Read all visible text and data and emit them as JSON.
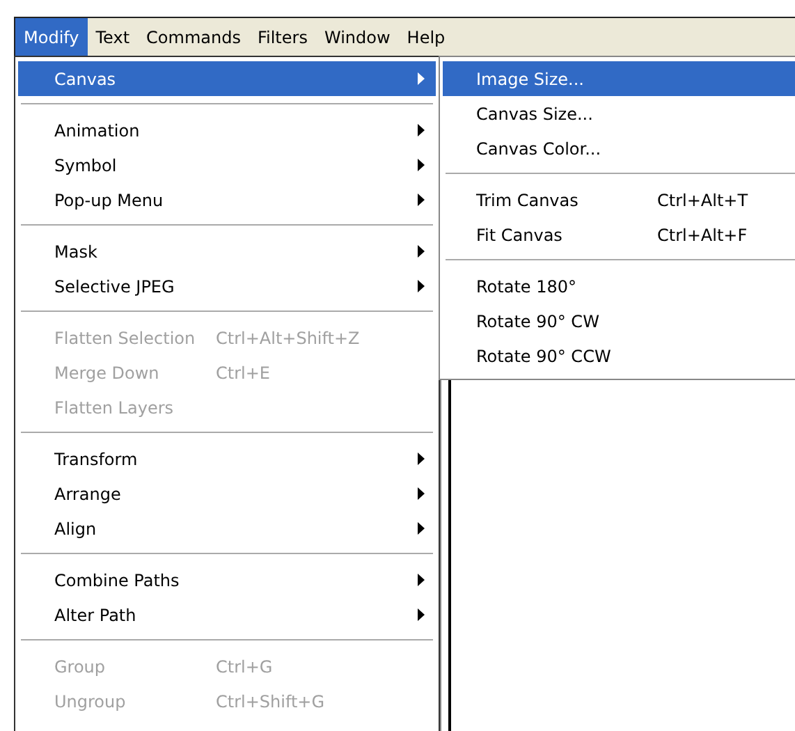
{
  "menubar": [
    {
      "label": "Modify",
      "selected": true
    },
    {
      "label": "Text",
      "selected": false
    },
    {
      "label": "Commands",
      "selected": false
    },
    {
      "label": "Filters",
      "selected": false
    },
    {
      "label": "Window",
      "selected": false
    },
    {
      "label": "Help",
      "selected": false
    }
  ],
  "menu": [
    {
      "kind": "item",
      "label": "Canvas",
      "submenu": true,
      "selected": true,
      "disabled": false
    },
    {
      "kind": "separator"
    },
    {
      "kind": "item",
      "label": "Animation",
      "submenu": true,
      "selected": false,
      "disabled": false
    },
    {
      "kind": "item",
      "label": "Symbol",
      "submenu": true,
      "selected": false,
      "disabled": false
    },
    {
      "kind": "item",
      "label": "Pop-up Menu",
      "submenu": true,
      "selected": false,
      "disabled": false
    },
    {
      "kind": "separator"
    },
    {
      "kind": "item",
      "label": "Mask",
      "submenu": true,
      "selected": false,
      "disabled": false
    },
    {
      "kind": "item",
      "label": "Selective JPEG",
      "submenu": true,
      "selected": false,
      "disabled": false
    },
    {
      "kind": "separator"
    },
    {
      "kind": "item",
      "label": "Flatten Selection",
      "shortcut": "Ctrl+Alt+Shift+Z",
      "selected": false,
      "disabled": true
    },
    {
      "kind": "item",
      "label": "Merge Down",
      "shortcut": "Ctrl+E",
      "selected": false,
      "disabled": true
    },
    {
      "kind": "item",
      "label": "Flatten Layers",
      "selected": false,
      "disabled": true
    },
    {
      "kind": "separator"
    },
    {
      "kind": "item",
      "label": "Transform",
      "submenu": true,
      "selected": false,
      "disabled": false
    },
    {
      "kind": "item",
      "label": "Arrange",
      "submenu": true,
      "selected": false,
      "disabled": false
    },
    {
      "kind": "item",
      "label": "Align",
      "submenu": true,
      "selected": false,
      "disabled": false
    },
    {
      "kind": "separator"
    },
    {
      "kind": "item",
      "label": "Combine Paths",
      "submenu": true,
      "selected": false,
      "disabled": false
    },
    {
      "kind": "item",
      "label": "Alter Path",
      "submenu": true,
      "selected": false,
      "disabled": false
    },
    {
      "kind": "separator"
    },
    {
      "kind": "item",
      "label": "Group",
      "shortcut": "Ctrl+G",
      "selected": false,
      "disabled": true
    },
    {
      "kind": "item",
      "label": "Ungroup",
      "shortcut": "Ctrl+Shift+G",
      "selected": false,
      "disabled": true
    }
  ],
  "submenu": [
    {
      "kind": "item",
      "label": "Image Size...",
      "selected": true,
      "disabled": false
    },
    {
      "kind": "item",
      "label": "Canvas Size...",
      "selected": false,
      "disabled": false
    },
    {
      "kind": "item",
      "label": "Canvas Color...",
      "selected": false,
      "disabled": false
    },
    {
      "kind": "separator"
    },
    {
      "kind": "item",
      "label": "Trim Canvas",
      "shortcut": "Ctrl+Alt+T",
      "selected": false,
      "disabled": false
    },
    {
      "kind": "item",
      "label": "Fit Canvas",
      "shortcut": "Ctrl+Alt+F",
      "selected": false,
      "disabled": false
    },
    {
      "kind": "separator"
    },
    {
      "kind": "item",
      "label": "Rotate 180°",
      "selected": false,
      "disabled": false
    },
    {
      "kind": "item",
      "label": "Rotate 90° CW",
      "selected": false,
      "disabled": false
    },
    {
      "kind": "item",
      "label": "Rotate 90° CCW",
      "selected": false,
      "disabled": false
    }
  ]
}
